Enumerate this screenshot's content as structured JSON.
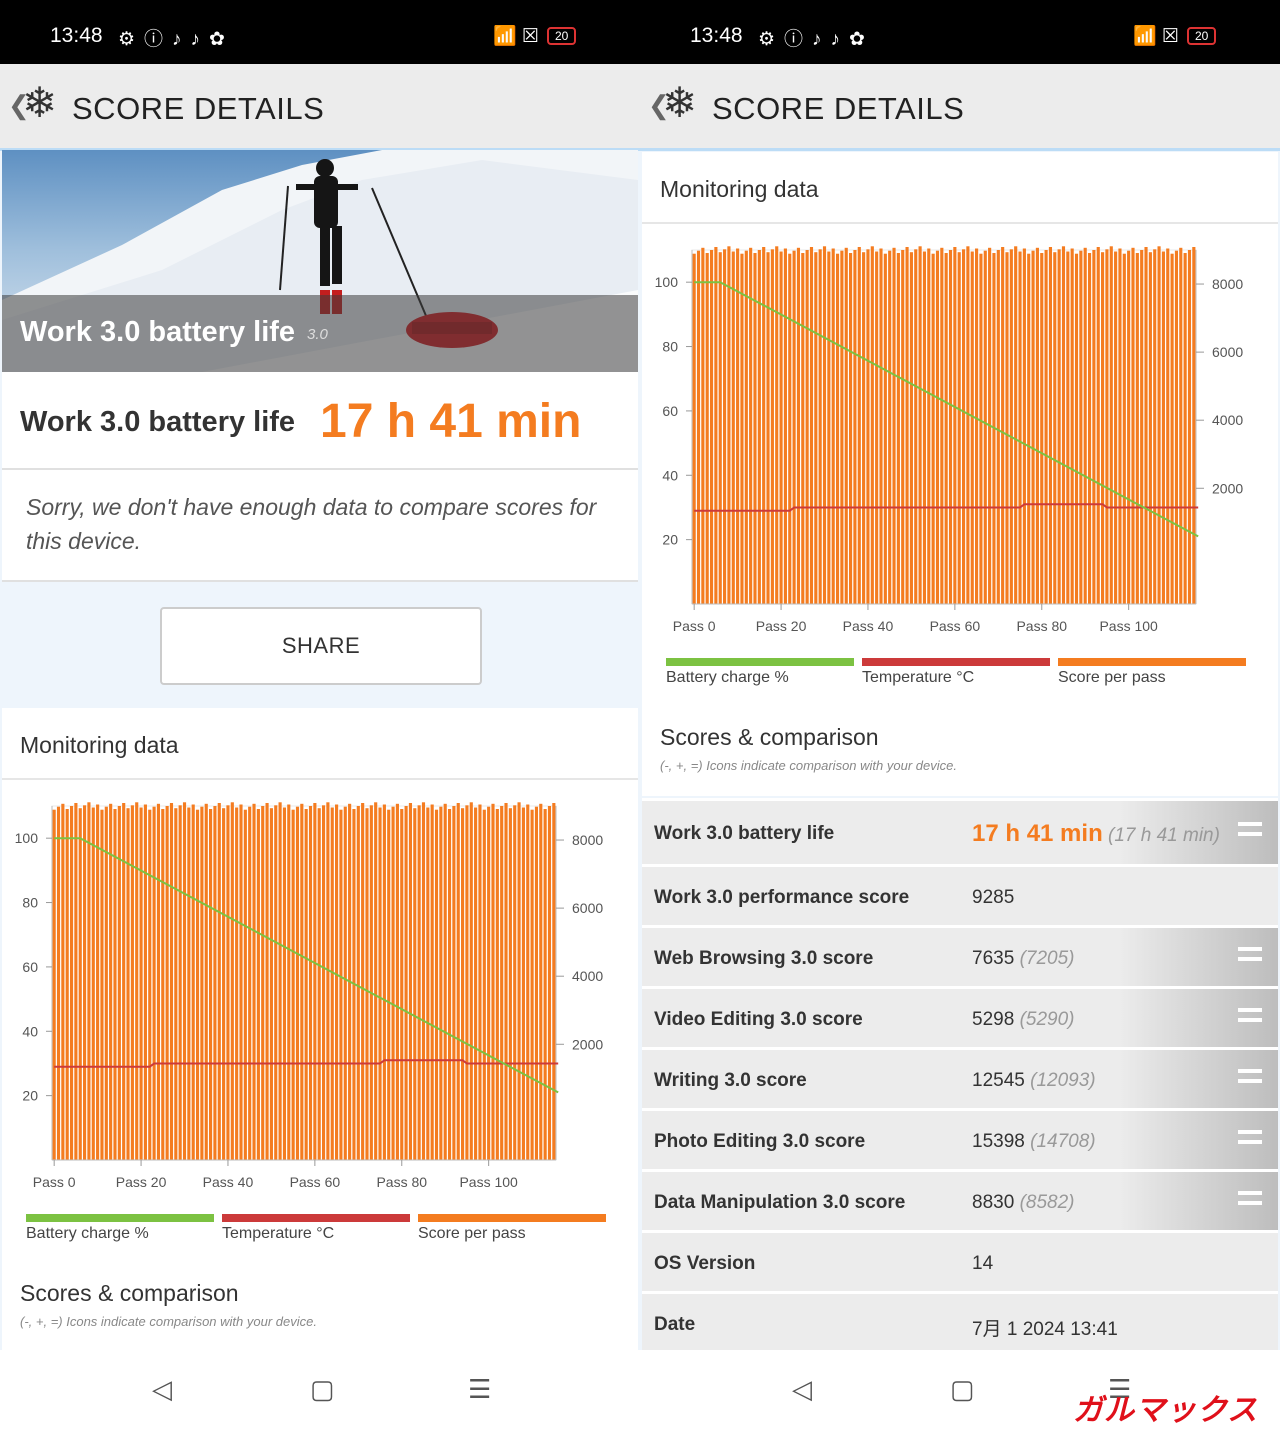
{
  "status": {
    "time": "13:48",
    "battery": "20"
  },
  "header": {
    "back_icon": "chevron-left-icon",
    "logo_icon": "snowflake-icon",
    "title": "SCORE DETAILS"
  },
  "hero": {
    "label": "Work 3.0 battery life",
    "version": "3.0"
  },
  "score": {
    "label": "Work 3.0 battery life",
    "value": "17 h 41 min"
  },
  "notice": "Sorry, we don't have enough data to compare scores for this device.",
  "share_label": "SHARE",
  "monitoring": {
    "title": "Monitoring data"
  },
  "legend": [
    "Battery charge %",
    "Temperature °C",
    "Score per pass"
  ],
  "colors": {
    "battery": "#7cc242",
    "temperature": "#cc3a3a",
    "score": "#f47c20",
    "accent": "#f47c20"
  },
  "scores_section": {
    "title": "Scores & comparison",
    "note": "(-, +, =) Icons indicate comparison with your device."
  },
  "results": [
    {
      "label": "Work 3.0 battery life",
      "value": "17 h 41 min",
      "compare": "(17 h 41 min)",
      "icon": "equal-icon"
    },
    {
      "label": "Work 3.0 performance score",
      "value": "9285",
      "compare": "",
      "icon": ""
    },
    {
      "label": "Web Browsing 3.0 score",
      "value": "7635",
      "compare": "(7205)",
      "icon": "equal-icon"
    },
    {
      "label": "Video Editing 3.0 score",
      "value": "5298",
      "compare": "(5290)",
      "icon": "equal-icon"
    },
    {
      "label": "Writing 3.0 score",
      "value": "12545",
      "compare": "(12093)",
      "icon": "equal-icon"
    },
    {
      "label": "Photo Editing 3.0 score",
      "value": "15398",
      "compare": "(14708)",
      "icon": "equal-icon"
    },
    {
      "label": "Data Manipulation 3.0 score",
      "value": "8830",
      "compare": "(8582)",
      "icon": "equal-icon"
    },
    {
      "label": "OS Version",
      "value": "14",
      "compare": "",
      "icon": ""
    },
    {
      "label": "Date",
      "value": "7月 1 2024 13:41",
      "compare": "",
      "icon": ""
    }
  ],
  "watermark": "ガルマックス",
  "chart_data": {
    "type": "bar",
    "passes": 116,
    "x_tick_labels": [
      "Pass 0",
      "Pass 20",
      "Pass 40",
      "Pass 60",
      "Pass 80",
      "Pass 100"
    ],
    "x_ticks": [
      0,
      20,
      40,
      60,
      80,
      100
    ],
    "y_left_ticks": [
      20,
      40,
      60,
      80,
      100
    ],
    "y_left_range": [
      0,
      110
    ],
    "y_right_ticks": [
      2000,
      4000,
      6000,
      8000
    ],
    "y_right_range": [
      -1400,
      9000
    ],
    "score_per_pass_approx": 9000,
    "battery_charge": [
      [
        0,
        100
      ],
      [
        6,
        100
      ],
      [
        116,
        21
      ]
    ],
    "temperature": [
      [
        0,
        29
      ],
      [
        22,
        29
      ],
      [
        23,
        30
      ],
      [
        75,
        30
      ],
      [
        76,
        31
      ],
      [
        94,
        31
      ],
      [
        95,
        30
      ],
      [
        116,
        30
      ]
    ],
    "series": [
      {
        "name": "Battery charge %",
        "axis": "left"
      },
      {
        "name": "Temperature °C",
        "axis": "left"
      },
      {
        "name": "Score per pass",
        "axis": "right"
      }
    ]
  }
}
